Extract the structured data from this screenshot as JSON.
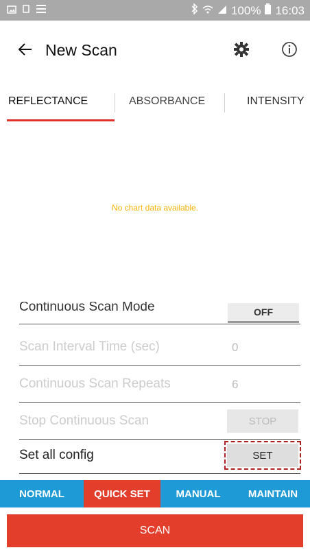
{
  "status_bar": {
    "icons_left": [
      "image-icon",
      "copy-icon",
      "list-icon"
    ],
    "bluetooth_icon": "bluetooth-icon",
    "wifi_icon": "wifi-icon",
    "signal_icon": "signal-icon",
    "battery": "100%",
    "time": "16:03"
  },
  "app_bar": {
    "back_icon": "back-arrow-icon",
    "title": "New Scan",
    "settings_icon": "gear-icon",
    "info_icon": "info-icon"
  },
  "tabs": [
    {
      "label": "REFLECTANCE",
      "selected": true
    },
    {
      "label": "ABSORBANCE",
      "selected": false
    },
    {
      "label": "INTENSITY",
      "selected": false
    }
  ],
  "chart": {
    "empty_message": "No chart data available."
  },
  "settings": [
    {
      "label": "Continuous Scan Mode",
      "control": "toggle",
      "value": "OFF"
    },
    {
      "label": "Scan Interval Time (sec)",
      "control": "input",
      "value": "0"
    },
    {
      "label": "Continuous Scan Repeats",
      "control": "input",
      "value": "6"
    },
    {
      "label": "Stop Continuous Scan",
      "control": "button",
      "value": "STOP"
    },
    {
      "label": "Set all config",
      "control": "button",
      "value": "SET"
    }
  ],
  "bottom_nav": [
    {
      "label": "NORMAL",
      "selected": false
    },
    {
      "label": "QUICK SET",
      "selected": true
    },
    {
      "label": "MANUAL",
      "selected": false
    },
    {
      "label": "MAINTAIN",
      "selected": false
    }
  ],
  "scan_button": {
    "label": "SCAN"
  },
  "colors": {
    "accent_red": "#e33e2b",
    "nav_blue": "#1e9ad6",
    "empty_text": "#f4b400"
  }
}
